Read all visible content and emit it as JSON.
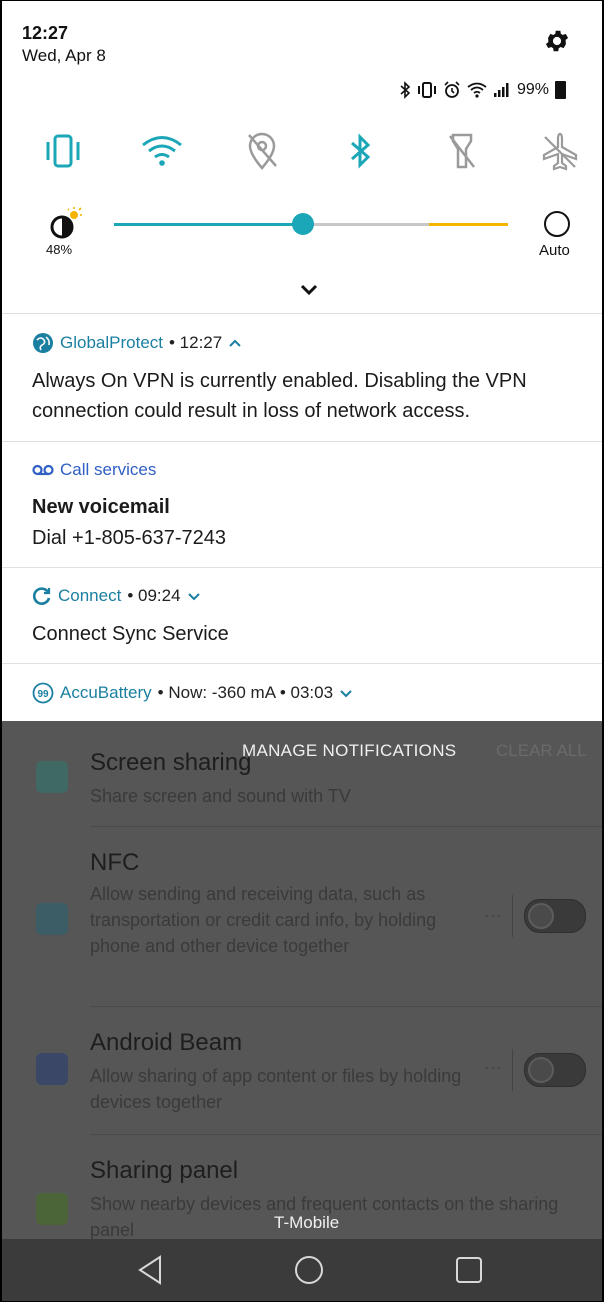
{
  "status_bar": {
    "time": "12:27",
    "date": "Wed, Apr 8",
    "battery": "99%",
    "icons": [
      "bluetooth-icon",
      "vibrate-icon",
      "alarm-icon",
      "wifi-icon",
      "signal-icon",
      "battery-icon"
    ]
  },
  "quick_settings": {
    "toggles": [
      {
        "name": "vibrate",
        "active": true
      },
      {
        "name": "wifi",
        "active": true
      },
      {
        "name": "location",
        "active": false
      },
      {
        "name": "bluetooth",
        "active": true
      },
      {
        "name": "flashlight",
        "active": false
      },
      {
        "name": "airplane",
        "active": false
      }
    ],
    "brightness_percent": "48%",
    "brightness_value": 0.48,
    "auto_label": "Auto",
    "accent": "#1ba7b7",
    "warm_accent": "#f4b400"
  },
  "notifications": [
    {
      "app": "GlobalProtect",
      "meta": "• 12:27",
      "body": "Always On VPN is currently enabled. Disabling the VPN connection could result in loss of network access."
    },
    {
      "app": "Call services",
      "title": "New voicemail",
      "body": "Dial +1-805-637-7243"
    },
    {
      "app": "Connect",
      "meta": "• 09:24",
      "body": "Connect Sync Service"
    },
    {
      "app": "AccuBattery",
      "meta": "• Now: -360 mA • 03:03"
    }
  ],
  "notif_actions": {
    "manage": "MANAGE NOTIFICATIONS",
    "clear_all": "CLEAR ALL"
  },
  "background_settings": [
    {
      "title": "Screen sharing",
      "subtitle": "Share screen and sound with TV"
    },
    {
      "title": "NFC",
      "subtitle": "Allow sending and receiving data, such as transportation or credit card info, by holding phone and other device together"
    },
    {
      "title": "Android Beam",
      "subtitle": "Allow sharing of app content or files by holding devices together"
    },
    {
      "title": "Sharing panel",
      "subtitle": "Show nearby devices and frequent contacts on the sharing panel"
    }
  ],
  "carrier": "T-Mobile",
  "more_glyph": "···"
}
